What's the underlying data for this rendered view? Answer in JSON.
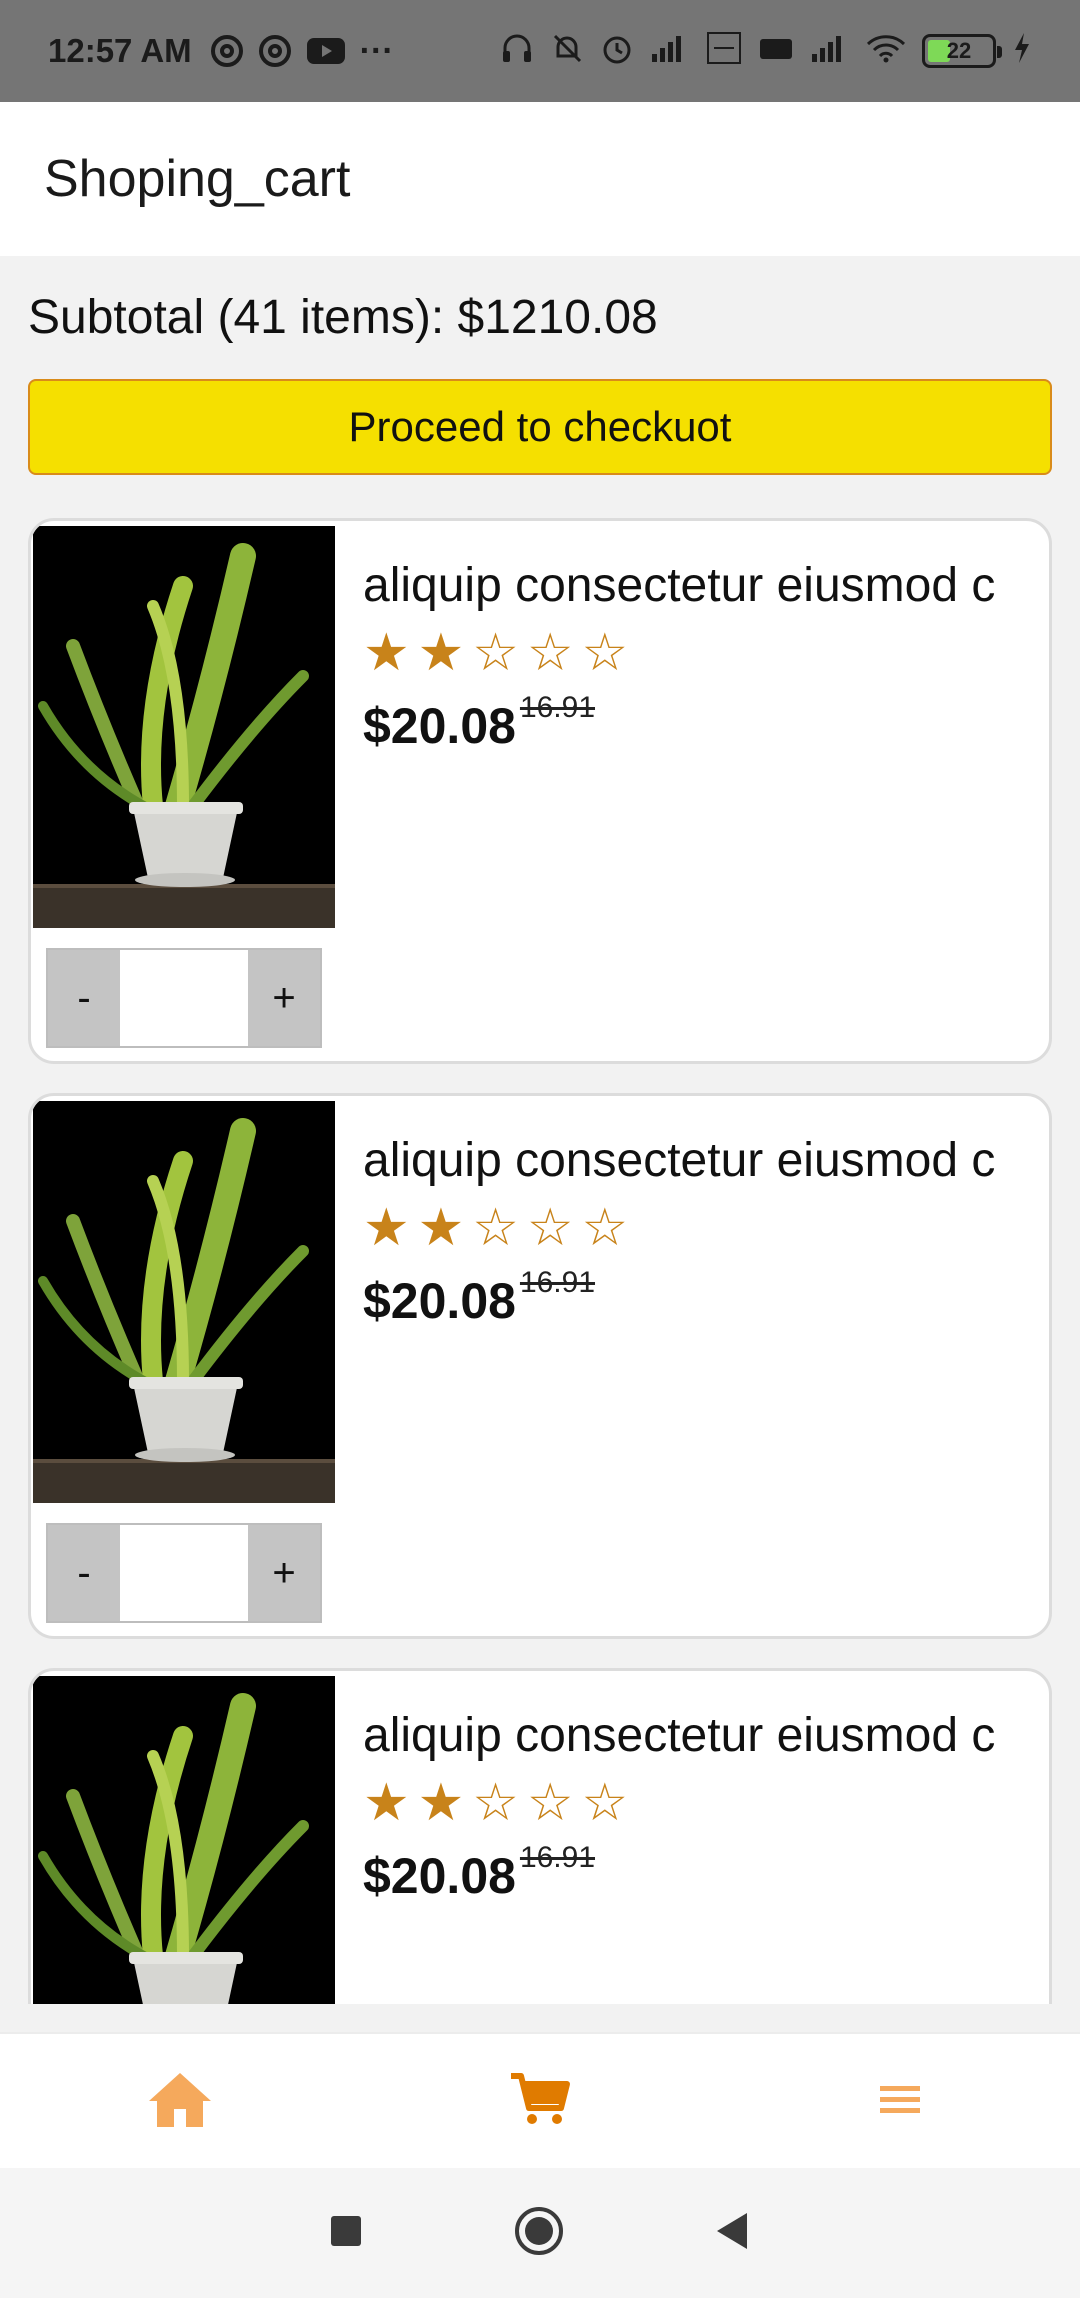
{
  "status_bar": {
    "time": "12:57 AM",
    "more": "···",
    "battery_level": "22"
  },
  "app": {
    "title": "Shoping_cart"
  },
  "cart": {
    "subtotal": "Subtotal (41 items): $1210.08",
    "checkout_label": "Proceed to checkuot"
  },
  "items": [
    {
      "name": "aliquip consectetur eiusmod c",
      "rating": 2,
      "max_rating": 5,
      "price": "$20.08",
      "old_price": "16.91",
      "qty_minus": "-",
      "qty_plus": "+",
      "qty_value": ""
    },
    {
      "name": "aliquip consectetur eiusmod c",
      "rating": 2,
      "max_rating": 5,
      "price": "$20.08",
      "old_price": "16.91",
      "qty_minus": "-",
      "qty_plus": "+",
      "qty_value": ""
    },
    {
      "name": "aliquip consectetur eiusmod c",
      "rating": 2,
      "max_rating": 5,
      "price": "$20.08",
      "old_price": "16.91",
      "qty_minus": "-",
      "qty_plus": "+",
      "qty_value": ""
    }
  ],
  "bottom_nav": [
    {
      "icon": "home-icon",
      "active": false
    },
    {
      "icon": "cart-icon",
      "active": true
    },
    {
      "icon": "menu-icon",
      "active": false
    }
  ],
  "colors": {
    "accent": "#e07b00",
    "accent_light": "#f5a95c",
    "checkout_bg": "#f5e000",
    "star": "#c8831a"
  }
}
